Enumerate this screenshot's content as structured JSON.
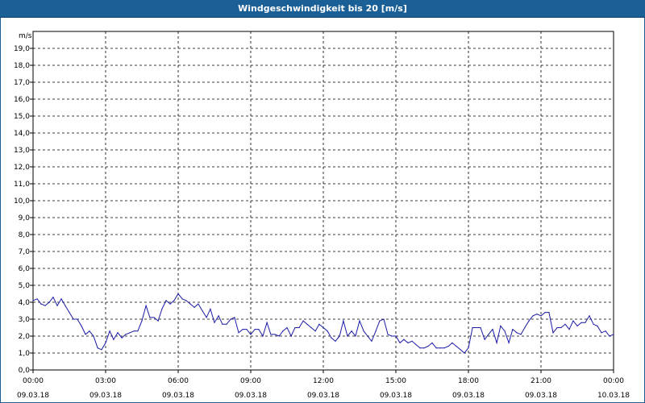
{
  "window": {
    "title": "Windgeschwindigkeit bis 20 [m/s]"
  },
  "chart_data": {
    "type": "line",
    "title": "Windgeschwindigkeit bis 20 [m/s]",
    "ylabel": "m/s",
    "xlabel": "",
    "ylim": [
      0,
      20
    ],
    "xlim_hours": [
      0,
      24
    ],
    "grid": true,
    "y_ticks": [
      "0,0",
      "1,0",
      "2,0",
      "3,0",
      "4,0",
      "5,0",
      "6,0",
      "7,0",
      "8,0",
      "9,0",
      "10,0",
      "11,0",
      "12,0",
      "13,0",
      "14,0",
      "15,0",
      "16,0",
      "17,0",
      "18,0",
      "19,0"
    ],
    "x_ticks": [
      {
        "time": "00:00",
        "date": "09.03.18"
      },
      {
        "time": "03:00",
        "date": "09.03.18"
      },
      {
        "time": "06:00",
        "date": "09.03.18"
      },
      {
        "time": "09:00",
        "date": "09.03.18"
      },
      {
        "time": "12:00",
        "date": "09.03.18"
      },
      {
        "time": "15:00",
        "date": "09.03.18"
      },
      {
        "time": "18:00",
        "date": "09.03.18"
      },
      {
        "time": "21:00",
        "date": "09.03.18"
      },
      {
        "time": "00:00",
        "date": "10.03.18"
      }
    ],
    "series": [
      {
        "color": "#1a1aa6",
        "points": [
          [
            0.0,
            4.1
          ],
          [
            0.17,
            4.2
          ],
          [
            0.33,
            3.9
          ],
          [
            0.5,
            3.8
          ],
          [
            0.67,
            4.0
          ],
          [
            0.83,
            4.3
          ],
          [
            1.0,
            3.8
          ],
          [
            1.17,
            4.2
          ],
          [
            1.33,
            3.8
          ],
          [
            1.5,
            3.4
          ],
          [
            1.67,
            3.0
          ],
          [
            1.83,
            3.0
          ],
          [
            2.0,
            2.6
          ],
          [
            2.17,
            2.1
          ],
          [
            2.33,
            2.3
          ],
          [
            2.5,
            2.0
          ],
          [
            2.67,
            1.3
          ],
          [
            2.83,
            1.2
          ],
          [
            3.0,
            1.6
          ],
          [
            3.17,
            2.3
          ],
          [
            3.33,
            1.8
          ],
          [
            3.5,
            2.2
          ],
          [
            3.67,
            1.9
          ],
          [
            3.83,
            2.1
          ],
          [
            4.0,
            2.2
          ],
          [
            4.17,
            2.3
          ],
          [
            4.33,
            2.3
          ],
          [
            4.5,
            2.9
          ],
          [
            4.67,
            3.8
          ],
          [
            4.83,
            3.1
          ],
          [
            5.0,
            3.1
          ],
          [
            5.17,
            2.9
          ],
          [
            5.33,
            3.6
          ],
          [
            5.5,
            4.1
          ],
          [
            5.67,
            3.9
          ],
          [
            5.83,
            4.1
          ],
          [
            6.0,
            4.5
          ],
          [
            6.17,
            4.2
          ],
          [
            6.33,
            4.1
          ],
          [
            6.5,
            3.9
          ],
          [
            6.67,
            3.7
          ],
          [
            6.83,
            3.9
          ],
          [
            7.0,
            3.5
          ],
          [
            7.17,
            3.1
          ],
          [
            7.33,
            3.6
          ],
          [
            7.5,
            2.8
          ],
          [
            7.67,
            3.2
          ],
          [
            7.83,
            2.7
          ],
          [
            8.0,
            2.7
          ],
          [
            8.17,
            3.0
          ],
          [
            8.33,
            3.1
          ],
          [
            8.5,
            2.2
          ],
          [
            8.67,
            2.4
          ],
          [
            8.83,
            2.4
          ],
          [
            9.0,
            2.1
          ],
          [
            9.17,
            2.4
          ],
          [
            9.33,
            2.4
          ],
          [
            9.5,
            2.0
          ],
          [
            9.67,
            2.8
          ],
          [
            9.83,
            2.1
          ],
          [
            10.0,
            2.1
          ],
          [
            10.17,
            2.0
          ],
          [
            10.33,
            2.3
          ],
          [
            10.5,
            2.5
          ],
          [
            10.67,
            2.0
          ],
          [
            10.83,
            2.5
          ],
          [
            11.0,
            2.5
          ],
          [
            11.17,
            2.9
          ],
          [
            11.33,
            2.7
          ],
          [
            11.5,
            2.5
          ],
          [
            11.67,
            2.3
          ],
          [
            11.83,
            2.7
          ],
          [
            12.0,
            2.5
          ],
          [
            12.17,
            2.3
          ],
          [
            12.33,
            1.9
          ],
          [
            12.5,
            1.7
          ],
          [
            12.67,
            2.0
          ],
          [
            12.83,
            2.9
          ],
          [
            13.0,
            2.0
          ],
          [
            13.17,
            2.3
          ],
          [
            13.33,
            2.0
          ],
          [
            13.5,
            2.9
          ],
          [
            13.67,
            2.3
          ],
          [
            13.83,
            2.0
          ],
          [
            14.0,
            1.7
          ],
          [
            14.17,
            2.3
          ],
          [
            14.33,
            2.9
          ],
          [
            14.5,
            3.0
          ],
          [
            14.67,
            2.1
          ],
          [
            14.83,
            2.0
          ],
          [
            15.0,
            2.0
          ],
          [
            15.17,
            1.6
          ],
          [
            15.33,
            1.8
          ],
          [
            15.5,
            1.6
          ],
          [
            15.67,
            1.7
          ],
          [
            15.83,
            1.5
          ],
          [
            16.0,
            1.3
          ],
          [
            16.17,
            1.3
          ],
          [
            16.33,
            1.4
          ],
          [
            16.5,
            1.6
          ],
          [
            16.67,
            1.3
          ],
          [
            16.83,
            1.3
          ],
          [
            17.0,
            1.3
          ],
          [
            17.17,
            1.4
          ],
          [
            17.33,
            1.6
          ],
          [
            17.5,
            1.4
          ],
          [
            17.67,
            1.2
          ],
          [
            17.83,
            1.0
          ],
          [
            18.0,
            1.3
          ],
          [
            18.17,
            2.5
          ],
          [
            18.33,
            2.5
          ],
          [
            18.5,
            2.5
          ],
          [
            18.67,
            1.8
          ],
          [
            18.83,
            2.1
          ],
          [
            19.0,
            2.4
          ],
          [
            19.17,
            1.6
          ],
          [
            19.33,
            2.6
          ],
          [
            19.5,
            2.3
          ],
          [
            19.67,
            1.6
          ],
          [
            19.83,
            2.4
          ],
          [
            20.0,
            2.2
          ],
          [
            20.17,
            2.1
          ],
          [
            20.33,
            2.5
          ],
          [
            20.5,
            2.9
          ],
          [
            20.67,
            3.2
          ],
          [
            20.83,
            3.3
          ],
          [
            21.0,
            3.2
          ],
          [
            21.17,
            3.4
          ],
          [
            21.33,
            3.4
          ],
          [
            21.5,
            2.2
          ],
          [
            21.67,
            2.5
          ],
          [
            21.83,
            2.5
          ],
          [
            22.0,
            2.7
          ],
          [
            22.17,
            2.4
          ],
          [
            22.33,
            2.9
          ],
          [
            22.5,
            2.6
          ],
          [
            22.67,
            2.8
          ],
          [
            22.83,
            2.8
          ],
          [
            23.0,
            3.2
          ],
          [
            23.17,
            2.7
          ],
          [
            23.33,
            2.6
          ],
          [
            23.5,
            2.2
          ],
          [
            23.67,
            2.3
          ],
          [
            23.83,
            2.0
          ],
          [
            24.0,
            2.1
          ]
        ]
      }
    ]
  }
}
